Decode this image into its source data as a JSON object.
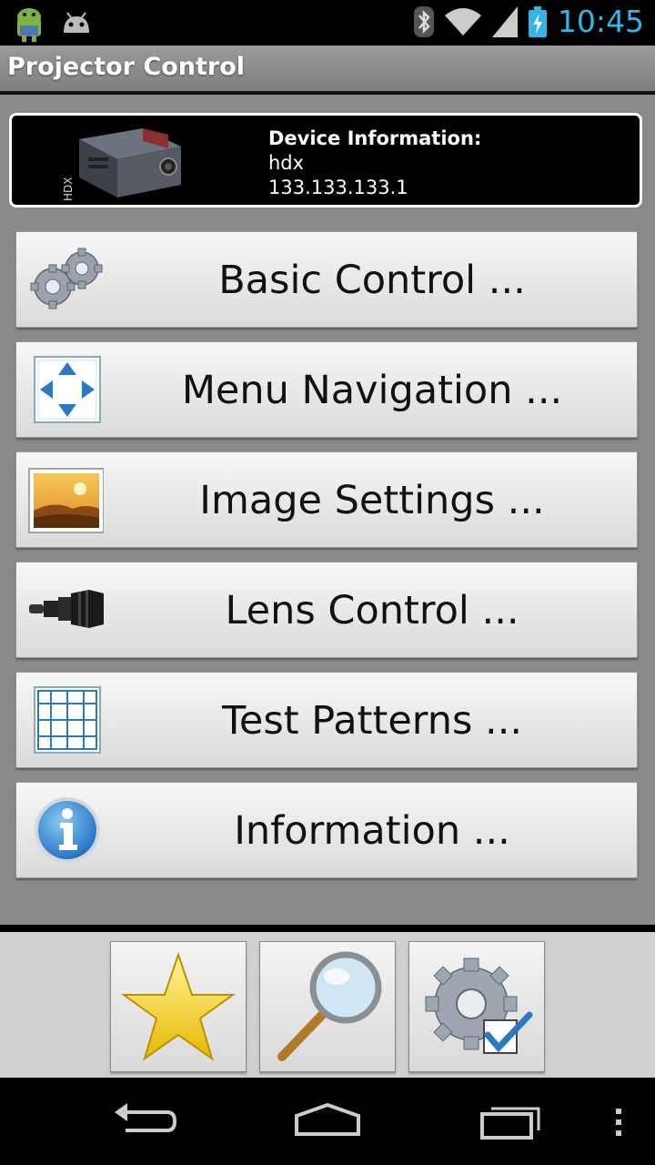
{
  "status_bar": {
    "time": "10:45",
    "icons": [
      "android-icon",
      "android-debug-icon",
      "bluetooth-icon",
      "wifi-icon",
      "signal-icon",
      "battery-charging-icon"
    ]
  },
  "app": {
    "title": "Projector Control"
  },
  "device": {
    "heading": "Device Information:",
    "name": "hdx",
    "ip": "133.133.133.1",
    "image_label": "HDX"
  },
  "menu": [
    {
      "label": "Basic Control ...",
      "icon": "gears-icon"
    },
    {
      "label": "Menu Navigation ...",
      "icon": "navigation-arrows-icon"
    },
    {
      "label": "Image Settings ...",
      "icon": "landscape-image-icon"
    },
    {
      "label": "Lens Control ...",
      "icon": "lens-icon"
    },
    {
      "label": "Test Patterns ...",
      "icon": "grid-pattern-icon"
    },
    {
      "label": "Information ...",
      "icon": "info-icon"
    }
  ],
  "toolbar": {
    "buttons": [
      "favorites-star-icon",
      "search-magnifier-icon",
      "settings-gear-check-icon"
    ]
  },
  "nav_bar": {
    "buttons": [
      "back-icon",
      "home-icon",
      "recent-apps-icon",
      "overflow-menu-icon"
    ]
  },
  "colors": {
    "clock": "#33b5e5",
    "background": "#8a8a8a",
    "title_bar": "#8f8f8f"
  }
}
